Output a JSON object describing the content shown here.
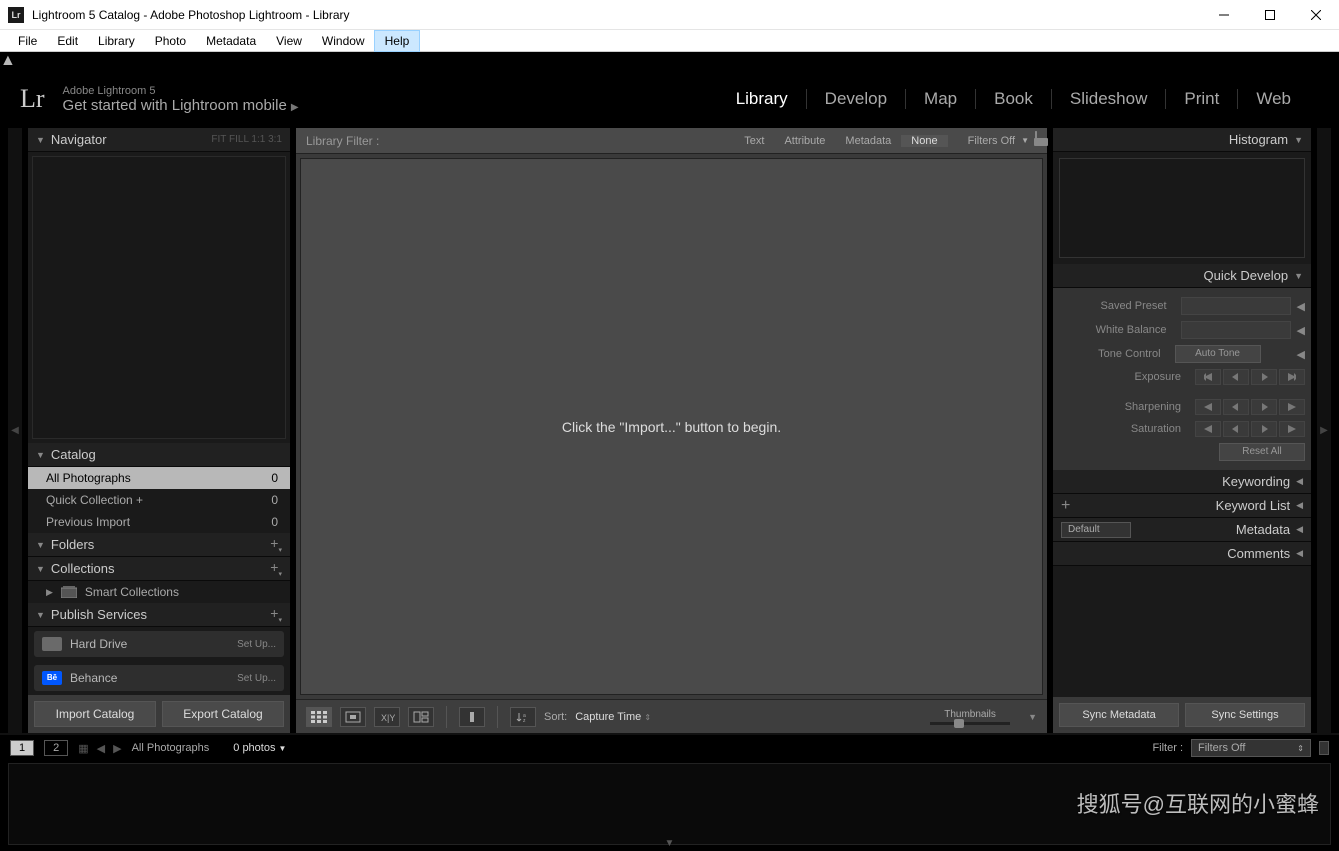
{
  "titlebar": {
    "title": "Lightroom 5 Catalog - Adobe Photoshop Lightroom - Library"
  },
  "menubar": [
    "File",
    "Edit",
    "Library",
    "Photo",
    "Metadata",
    "View",
    "Window",
    "Help"
  ],
  "menubar_open": "Help",
  "brand": {
    "line1": "Adobe Lightroom 5",
    "line2": "Get started with Lightroom mobile"
  },
  "modules": [
    "Library",
    "Develop",
    "Map",
    "Book",
    "Slideshow",
    "Print",
    "Web"
  ],
  "modules_active": "Library",
  "left": {
    "navigator": {
      "title": "Navigator",
      "opts": "FIT   FILL   1:1   3:1"
    },
    "catalog": {
      "title": "Catalog",
      "items": [
        {
          "label": "All Photographs",
          "count": "0",
          "sel": true
        },
        {
          "label": "Quick Collection  +",
          "count": "0"
        },
        {
          "label": "Previous Import",
          "count": "0"
        }
      ]
    },
    "folders": {
      "title": "Folders"
    },
    "collections": {
      "title": "Collections",
      "sub": "Smart Collections"
    },
    "publish": {
      "title": "Publish Services",
      "items": [
        {
          "label": "Hard Drive",
          "setup": "Set Up...",
          "color": "#6a6a6a"
        },
        {
          "label": "Behance",
          "setup": "Set Up...",
          "color": "#0057ff"
        }
      ]
    },
    "buttons": {
      "import": "Import Catalog",
      "export": "Export Catalog"
    }
  },
  "center": {
    "filter": {
      "label": "Library Filter :",
      "tabs": [
        "Text",
        "Attribute",
        "Metadata",
        "None"
      ],
      "active": "None",
      "right": "Filters Off"
    },
    "empty_msg": "Click the \"Import...\" button to begin.",
    "toolbar": {
      "sort_label": "Sort:",
      "sort_value": "Capture Time",
      "thumbs": "Thumbnails"
    }
  },
  "right": {
    "histogram": "Histogram",
    "qd": {
      "title": "Quick Develop",
      "preset": "Saved Preset",
      "wb": "White Balance",
      "tone": "Tone Control",
      "auto": "Auto Tone",
      "exposure": "Exposure",
      "sharp": "Sharpening",
      "sat": "Saturation",
      "reset": "Reset All"
    },
    "keywording": "Keywording",
    "keyword_list": "Keyword List",
    "metadata": "Metadata",
    "metadata_preset": "Default",
    "comments": "Comments",
    "sync": {
      "meta": "Sync Metadata",
      "settings": "Sync Settings"
    }
  },
  "filmstrip": {
    "badges": [
      "1",
      "2"
    ],
    "crumb": "All Photographs",
    "count": "0 photos",
    "filter_label": "Filter :",
    "filter_value": "Filters Off"
  },
  "watermark": "搜狐号@互联网的小蜜蜂"
}
